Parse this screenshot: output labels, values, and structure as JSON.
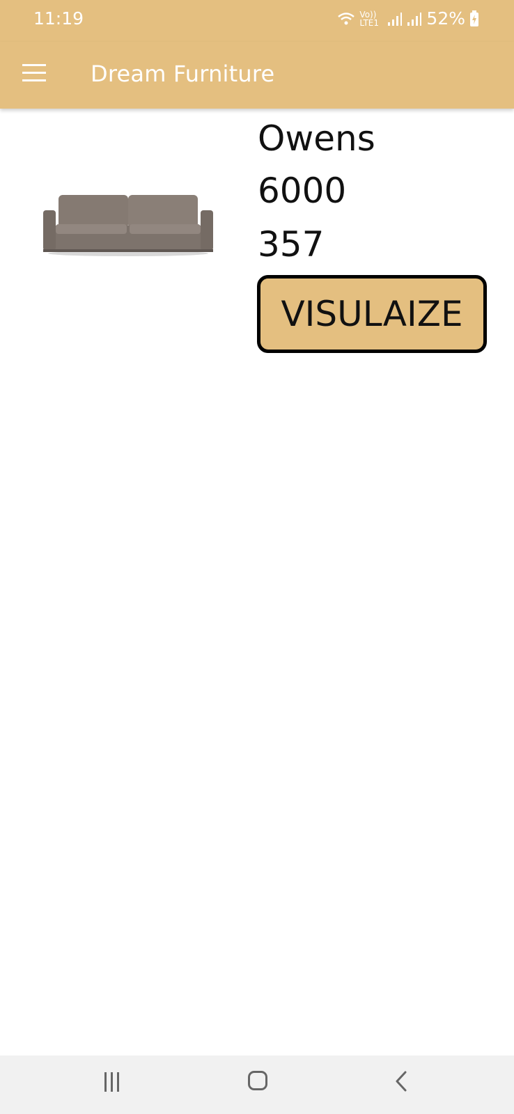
{
  "status_bar": {
    "time": "11:19",
    "network_label": "Vo)) LTE1",
    "battery_percent": "52%"
  },
  "app_bar": {
    "title": "Dream Furniture",
    "menu_icon": "hamburger-menu-icon"
  },
  "product": {
    "name": "Owens",
    "price": "6000",
    "code": "357",
    "image_icon": "sofa-image",
    "visualize_label": "VISULAIZE"
  },
  "nav_bar": {
    "recents_icon": "recents-icon",
    "home_icon": "home-icon",
    "back_icon": "back-icon"
  },
  "colors": {
    "primary": "#e4bf80",
    "text": "#111111",
    "background": "#ffffff",
    "navbar": "#f1f1f1"
  }
}
